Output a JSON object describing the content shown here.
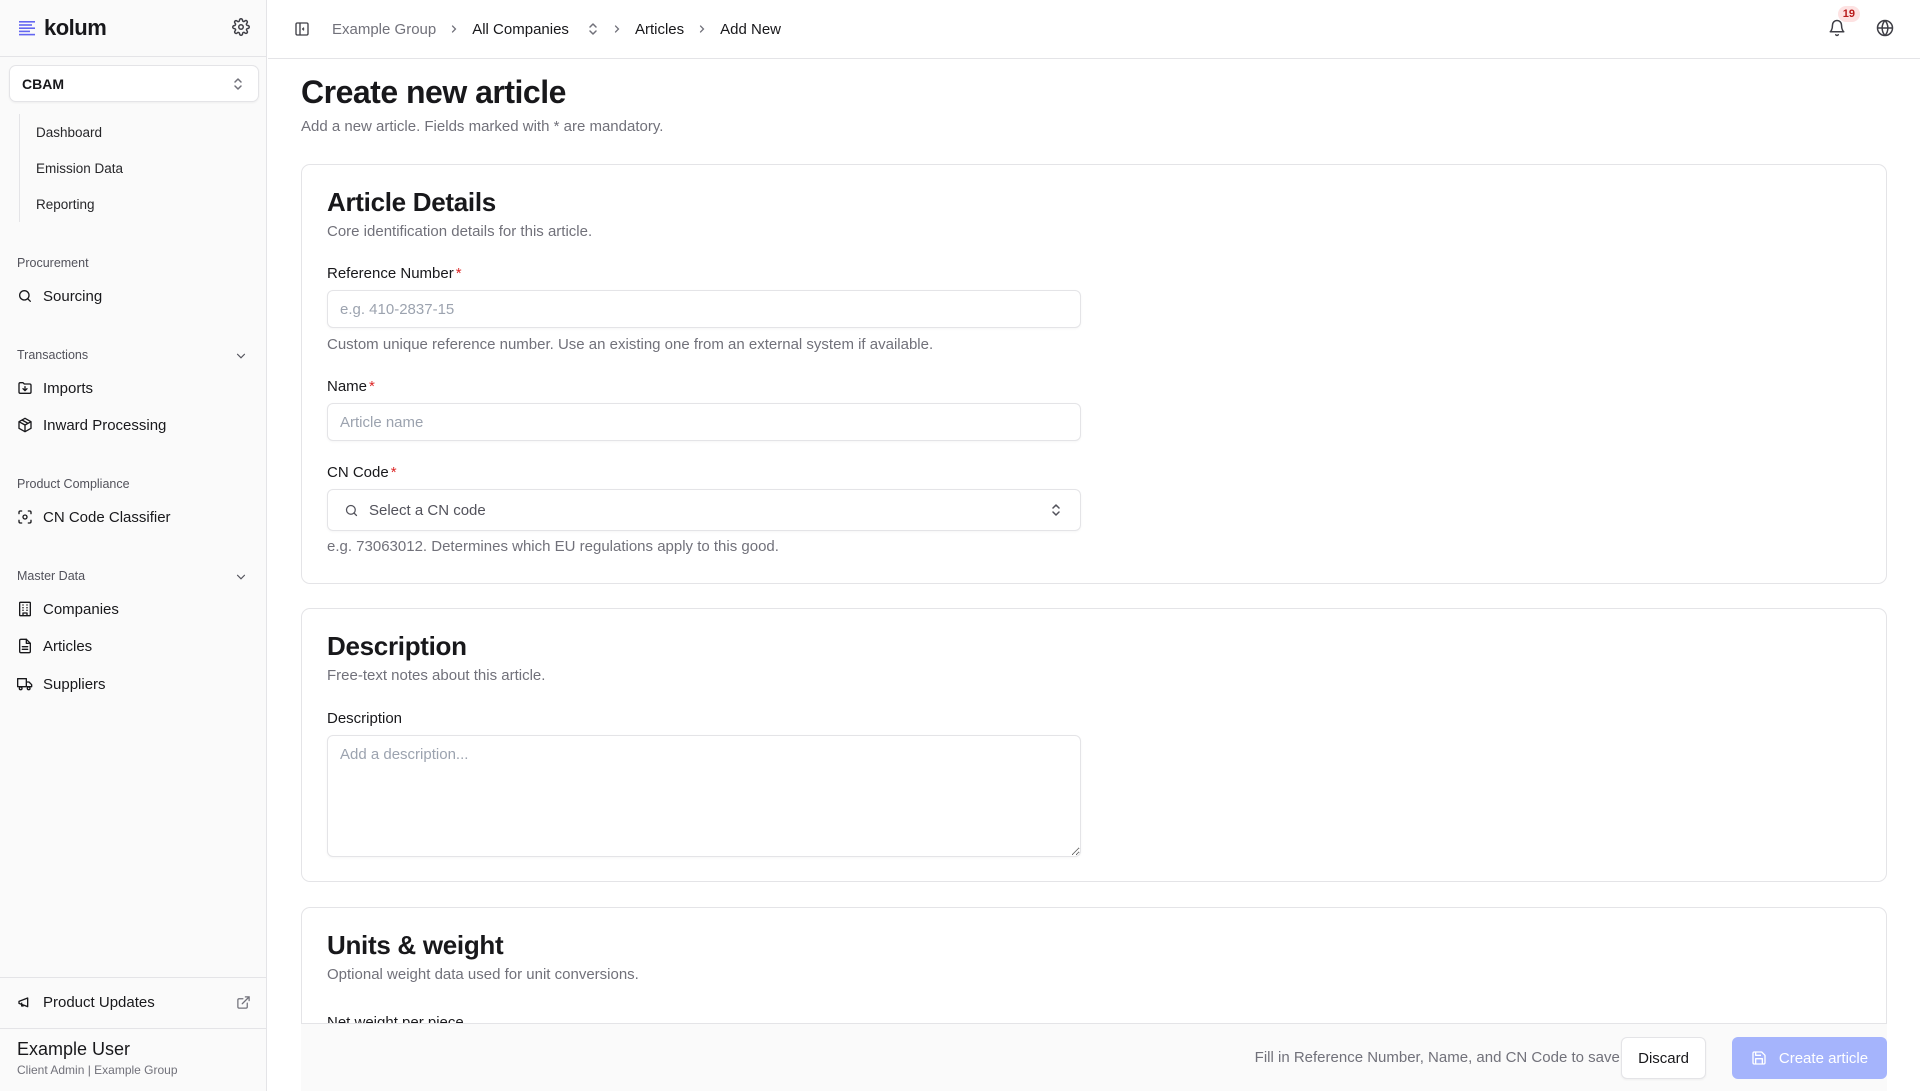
{
  "app": {
    "name": "kolum"
  },
  "sidebar": {
    "workspace": "CBAM",
    "cbam_items": [
      "Dashboard",
      "Emission Data",
      "Reporting"
    ],
    "groups": {
      "procurement": "Procurement",
      "transactions": "Transactions",
      "product_compliance": "Product Compliance",
      "master_data": "Master Data"
    },
    "items": {
      "sourcing": "Sourcing",
      "imports": "Imports",
      "inward_processing": "Inward Processing",
      "cn_code_classifier": "CN Code Classifier",
      "companies": "Companies",
      "articles": "Articles",
      "suppliers": "Suppliers"
    },
    "product_updates": "Product Updates",
    "user": {
      "name": "Example User",
      "role": "Client Admin | Example Group"
    }
  },
  "topbar": {
    "breadcrumb": [
      "Example Group",
      "All Companies",
      "Articles",
      "Add New"
    ],
    "notification_count": "19"
  },
  "page": {
    "title": "Create new article",
    "subtitle": "Add a new article. Fields marked with * are mandatory."
  },
  "article_details": {
    "title": "Article Details",
    "subtitle": "Core identification details for this article.",
    "reference_label": "Reference Number",
    "reference_placeholder": "e.g. 410-2837-15",
    "reference_help": "Custom unique reference number. Use an existing one from an external system if available.",
    "name_label": "Name",
    "name_placeholder": "Article name",
    "cn_label": "CN Code",
    "cn_placeholder": "Select a CN code",
    "cn_help": "e.g. 73063012. Determines which EU regulations apply to this good.",
    "required_mark": "*"
  },
  "description": {
    "title": "Description",
    "subtitle": "Free-text notes about this article.",
    "label": "Description",
    "placeholder": "Add a description..."
  },
  "units": {
    "title": "Units & weight",
    "subtitle": "Optional weight data used for unit conversions.",
    "net_weight_label": "Net weight per piece"
  },
  "footer": {
    "hint": "Fill in Reference Number, Name, and CN Code to save.",
    "discard": "Discard",
    "create": "Create article"
  },
  "colors": {
    "accent": "#4f46e5",
    "accent_disabled": "#a5b4fc",
    "required": "#dc2626"
  }
}
